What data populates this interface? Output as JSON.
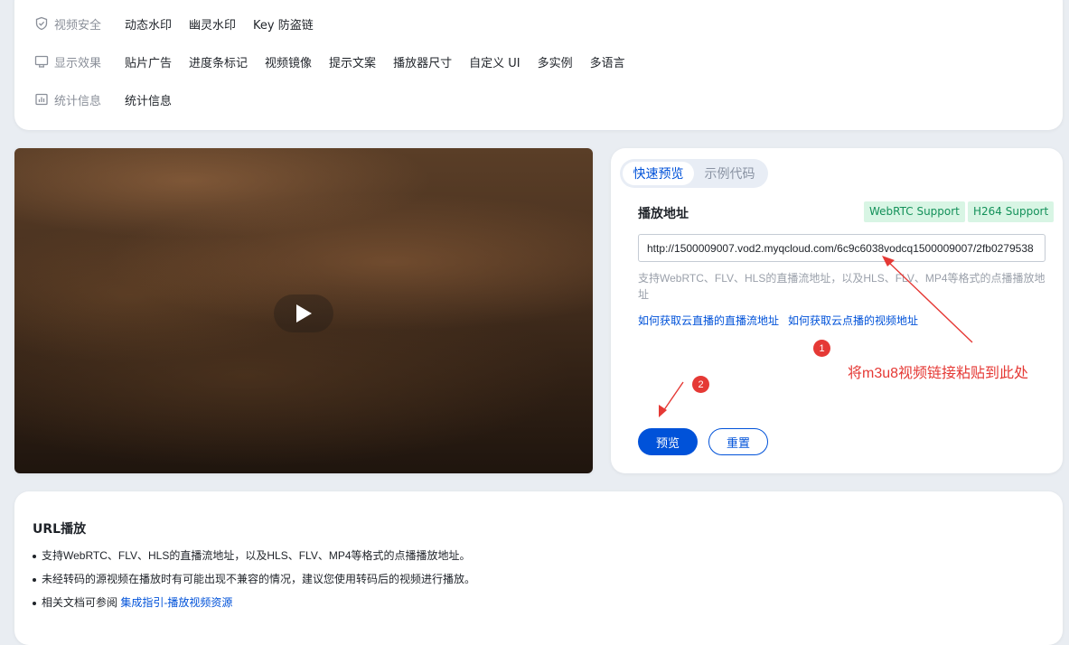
{
  "features": [
    {
      "category": "视频安全",
      "icon": "shield-icon",
      "items": [
        "动态水印",
        "幽灵水印",
        "Key 防盗链"
      ]
    },
    {
      "category": "显示效果",
      "icon": "monitor-icon",
      "items": [
        "贴片广告",
        "进度条标记",
        "视频镜像",
        "提示文案",
        "播放器尺寸",
        "自定义 UI",
        "多实例",
        "多语言"
      ]
    },
    {
      "category": "统计信息",
      "icon": "chart-icon",
      "items": [
        "统计信息"
      ]
    }
  ],
  "panel": {
    "tabs": [
      "快速预览",
      "示例代码"
    ],
    "active_tab": "快速预览",
    "address_label": "播放地址",
    "badges": [
      "WebRTC Support",
      "H264 Support"
    ],
    "url_value": "http://1500009007.vod2.myqcloud.com/6c9c6038vodcq1500009007/2fb0279538",
    "hint": "支持WebRTC、FLV、HLS的直播流地址，以及HLS、FLV、MP4等格式的点播播放地址",
    "link_live": "如何获取云直播的直播流地址",
    "link_vod": "如何获取云点播的视频地址",
    "marker1": "1",
    "marker2": "2",
    "annotation": "将m3u8视频链接粘贴到此处",
    "preview_button": "预览",
    "reset_button": "重置"
  },
  "bottom": {
    "title": "URL播放",
    "bullets": [
      "支持WebRTC、FLV、HLS的直播流地址，以及HLS、FLV、MP4等格式的点播播放地址。",
      "未经转码的源视频在播放时有可能出现不兼容的情况，建议您使用转码后的视频进行播放。",
      "相关文档可参阅"
    ],
    "doc_link": "集成指引-播放视频资源"
  },
  "colors": {
    "accent": "#0052d9",
    "annotation": "#e53935",
    "badge_bg": "#d8f5e4",
    "badge_text": "#14915a"
  }
}
